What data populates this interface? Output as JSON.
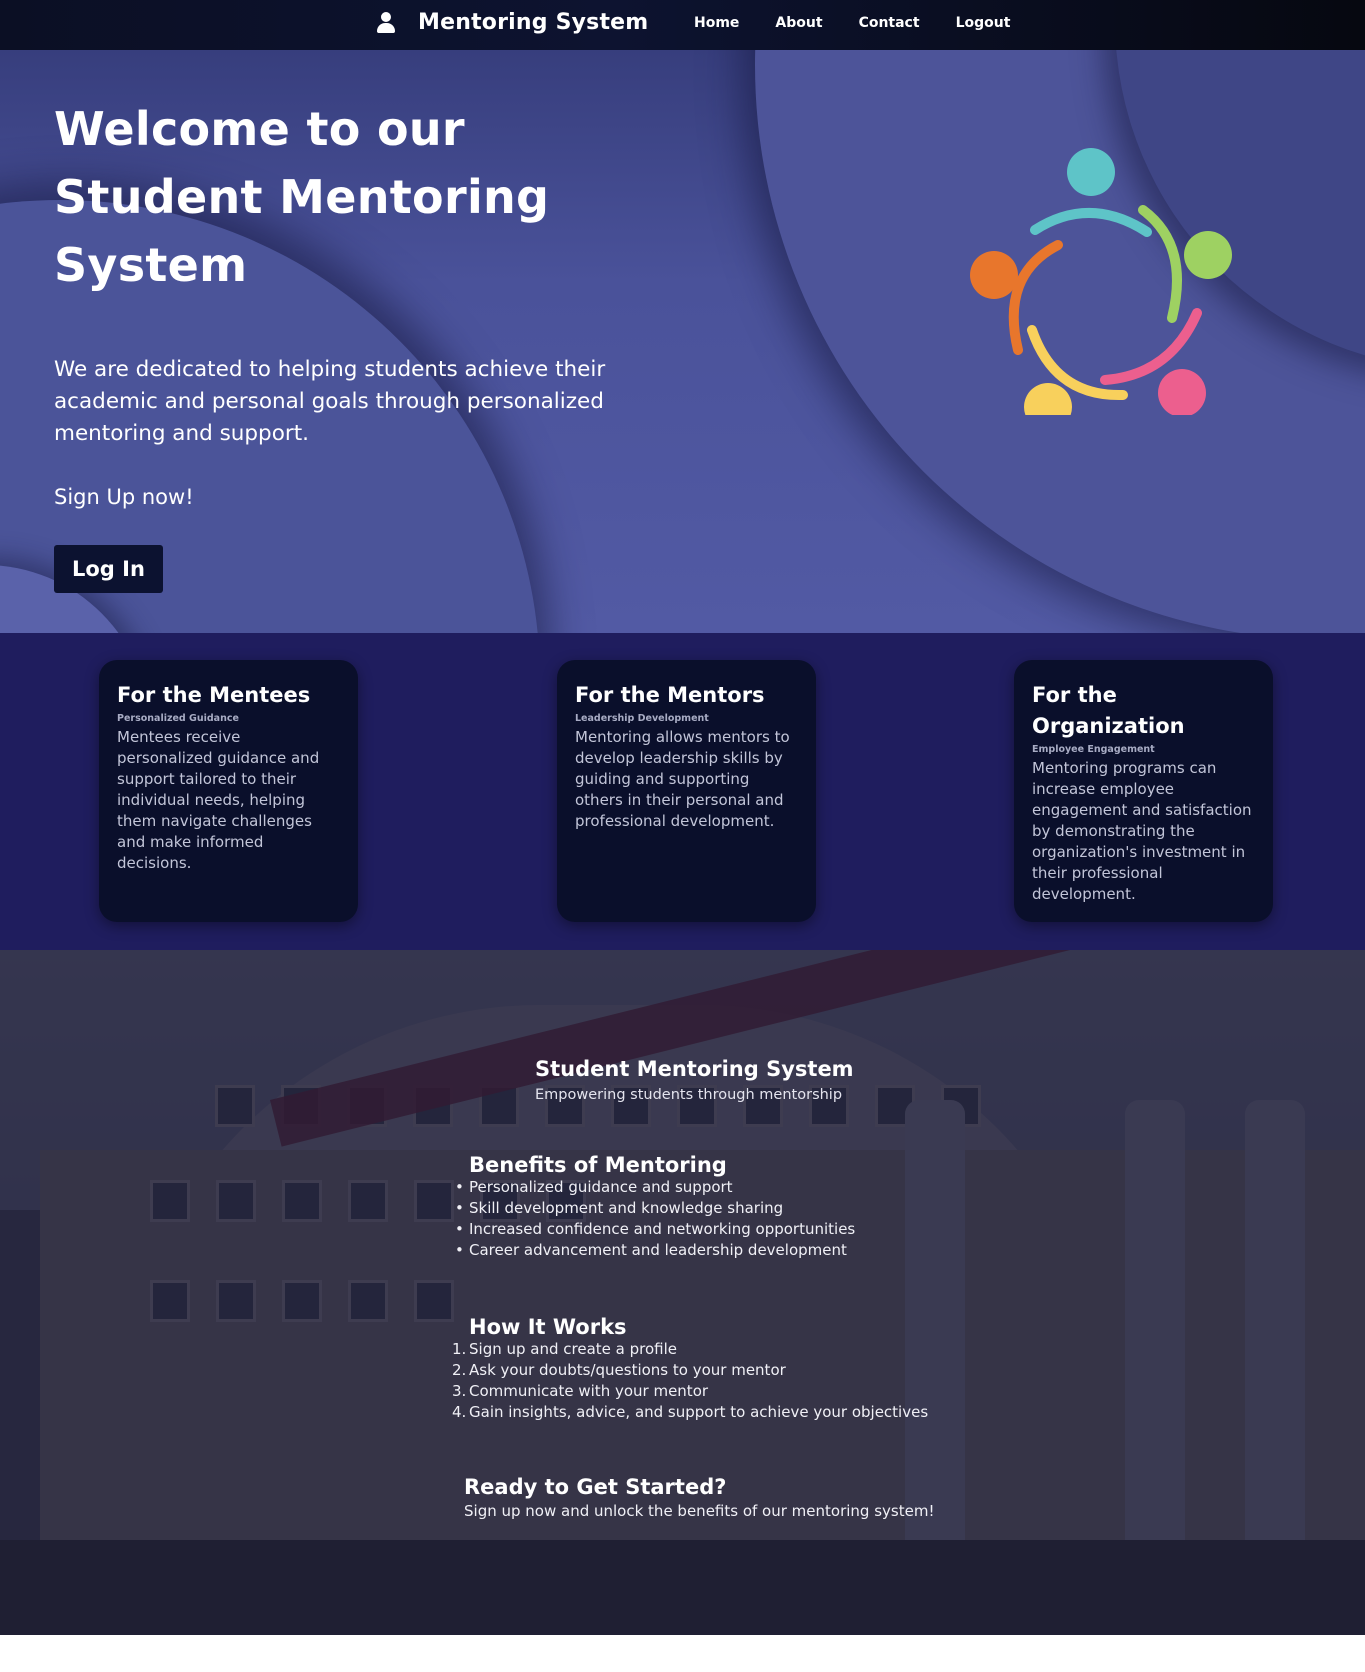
{
  "nav": {
    "brand": "Mentoring System",
    "links": [
      "Home",
      "About",
      "Contact",
      "Logout"
    ]
  },
  "hero": {
    "title": "Welcome to our Student Mentoring System",
    "description": "We are dedicated to helping students achieve their academic and personal goals through personalized mentoring and support.",
    "signup_text": "Sign Up now!",
    "login_label": "Log In",
    "logo_colors": [
      "#5ec4c8",
      "#9ed162",
      "#ec5f8e",
      "#f8d05c",
      "#e8762c"
    ]
  },
  "features": [
    {
      "title": "For the Mentees",
      "subtitle": "Personalized Guidance",
      "text": "Mentees receive personalized guidance and support tailored to their individual needs, helping them navigate challenges and make informed decisions."
    },
    {
      "title": "For the Mentors",
      "subtitle": "Leadership Development",
      "text": "Mentoring allows mentors to develop leadership skills by guiding and supporting others in their personal and professional development."
    },
    {
      "title": "For the Organization",
      "subtitle": "Employee Engagement",
      "text": "Mentoring programs can increase employee engagement and satisfaction by demonstrating the organization's investment in their professional development."
    }
  ],
  "campus": {
    "title": "Student Mentoring System",
    "subtitle": "Empowering students through mentorship",
    "benefits_heading": "Benefits of Mentoring",
    "benefits": [
      "Personalized guidance and support",
      "Skill development and knowledge sharing",
      "Increased confidence and networking opportunities",
      "Career advancement and leadership development"
    ],
    "how_heading": "How It Works",
    "steps": [
      "Sign up and create a profile",
      "Ask your doubts/questions to your mentor",
      "Communicate with your mentor",
      "Gain insights, advice, and support to achieve your objectives"
    ],
    "ready_heading": "Ready to Get Started?",
    "ready_text": "Sign up now and unlock the benefits of our mentoring system!"
  }
}
